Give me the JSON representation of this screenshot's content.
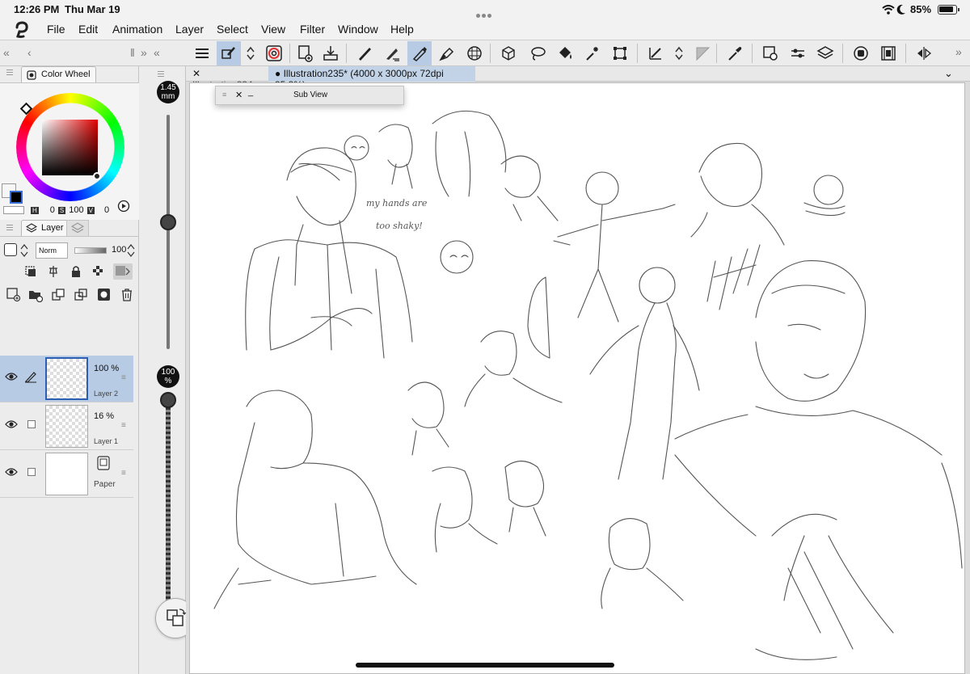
{
  "status_bar": {
    "time": "12:26 PM",
    "date": "Thu Mar 19",
    "battery": "85%"
  },
  "menu": [
    "File",
    "Edit",
    "Animation",
    "Layer",
    "Select",
    "View",
    "Filter",
    "Window",
    "Help"
  ],
  "toolbar": {
    "icons": [
      "hamburger-menu-icon",
      "pen-tool-icon",
      "up-down-icon",
      "spiral-icon",
      "new-canvas-icon",
      "import-icon",
      "pencil-icon",
      "fountain-pen-icon",
      "g-pen-icon",
      "marker-icon",
      "grid-icon",
      "3d-cube-icon",
      "lasso-icon",
      "fill-bucket-icon",
      "magic-wand-icon",
      "transform-icon",
      "ruler-icon",
      "up-down-icon",
      "triangle-icon",
      "eyedropper-icon",
      "layer-property-icon",
      "adjust-sliders-icon",
      "layers-stack-icon",
      "circle-icon",
      "film-icon",
      "flip-icon"
    ],
    "active_tools": [
      "pen-tool-icon",
      "g-pen-icon"
    ]
  },
  "color_panel": {
    "tab_label": "Color Wheel",
    "h_label": "H",
    "h_value": "0",
    "s_label": "S",
    "s_value": "100",
    "v_label": "V",
    "v_value": "0"
  },
  "layer_panel": {
    "tab_label": "Layer",
    "blend_mode": "Norm",
    "opacity": "100",
    "layers": [
      {
        "opacity": "100 %",
        "name": "Layer 2",
        "visible": true,
        "selected": true
      },
      {
        "opacity": "16 %",
        "name": "Layer 1",
        "visible": true,
        "selected": false
      },
      {
        "opacity": "",
        "name": "Paper",
        "visible": true,
        "selected": false
      }
    ]
  },
  "brush": {
    "size_value": "1.45",
    "size_unit": "mm",
    "opacity_value": "100",
    "opacity_unit": "%"
  },
  "documents": {
    "tabs": [
      {
        "label": "Illustration234",
        "active": false
      },
      {
        "label": "Illustration235* (4000 x 3000px 72dpi 85.8%)",
        "active": true
      }
    ]
  },
  "sub_view": {
    "title": "Sub View"
  },
  "canvas": {
    "sketch_note": "my hands are too shaky!"
  },
  "colors": {
    "accent": "#b7cbe4",
    "active_tab": "#c2d3e8",
    "paper": "#ffffff"
  }
}
